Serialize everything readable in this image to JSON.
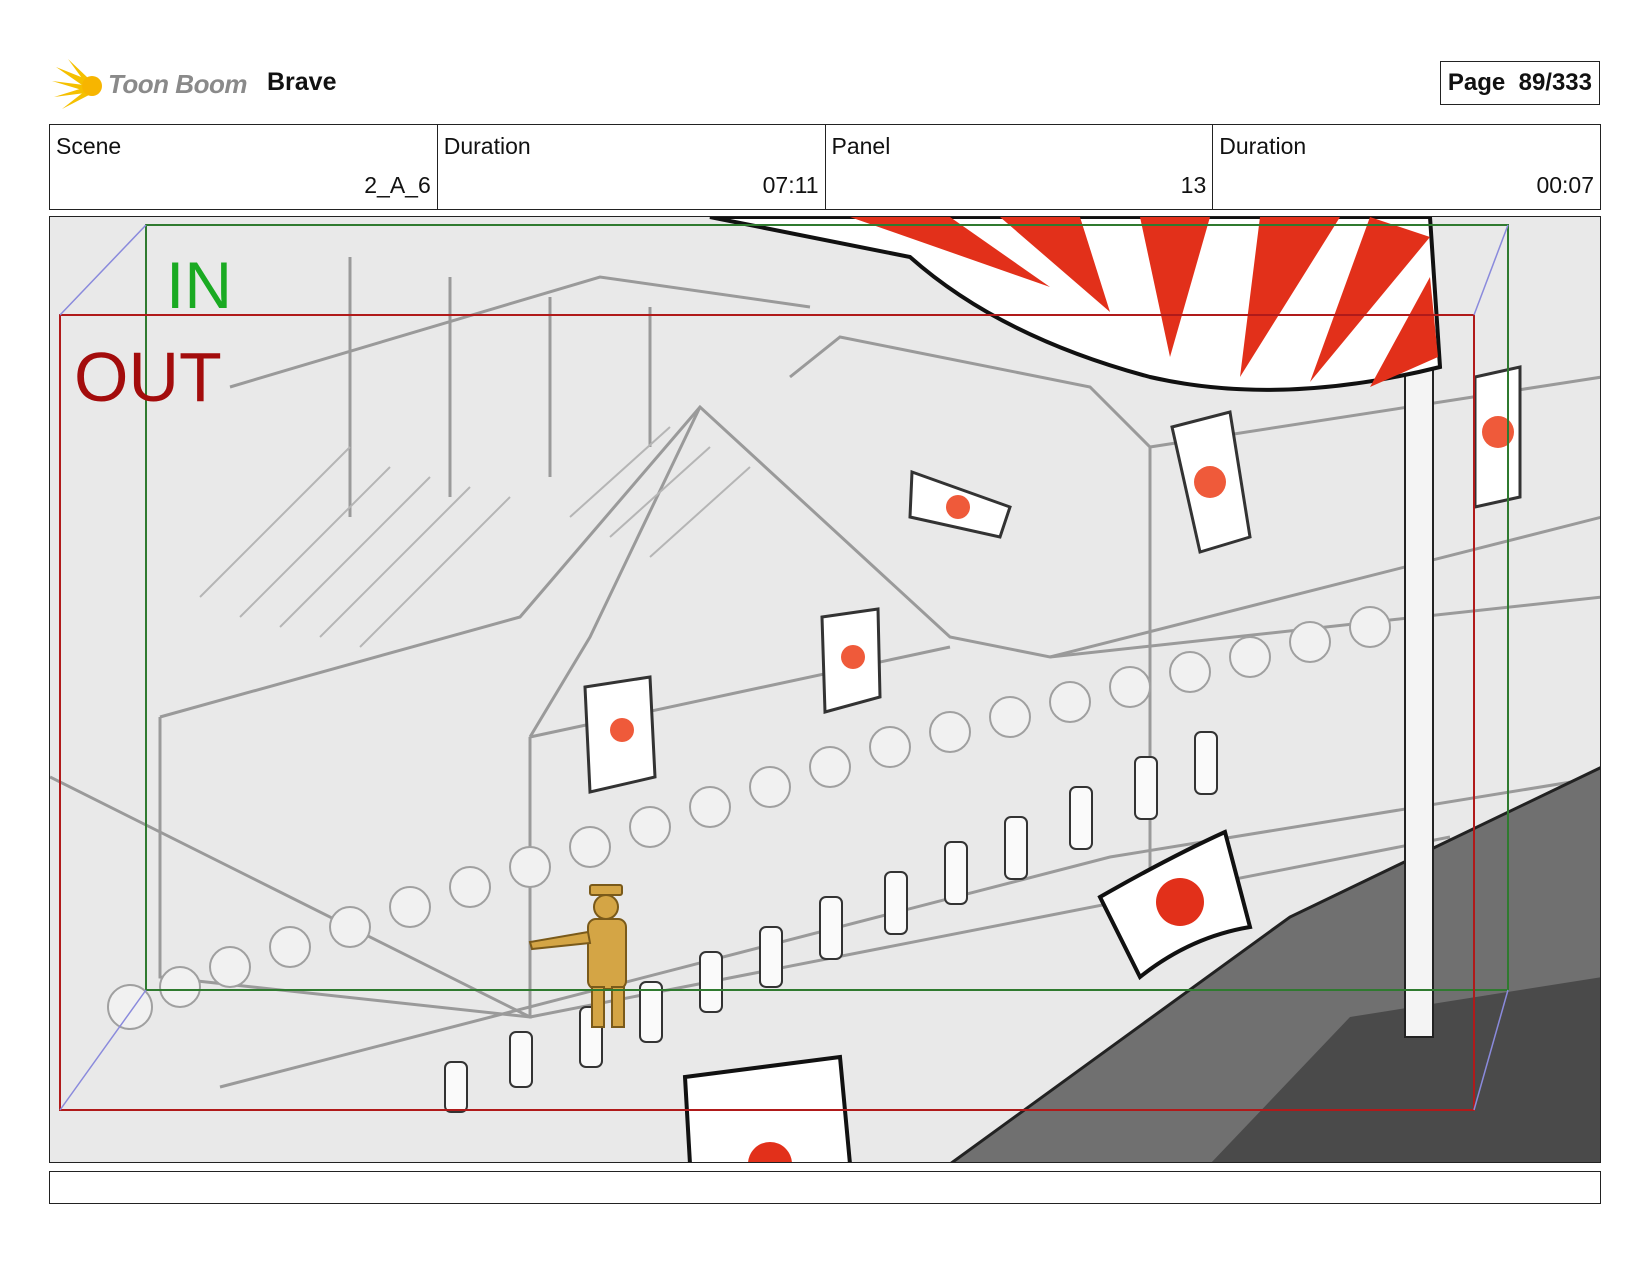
{
  "header": {
    "brand": "Toon Boom",
    "project": "Brave",
    "page_label": "Page",
    "page_number": "89/333",
    "brand_color": "#f5c000"
  },
  "info": {
    "scene_label": "Scene",
    "scene_value": "2_A_6",
    "duration_label": "Duration",
    "duration_value": "07:11",
    "panel_label": "Panel",
    "panel_value": "13",
    "panel_duration_label": "Duration",
    "panel_duration_value": "00:07"
  },
  "frame": {
    "in_label": "IN",
    "out_label": "OUT",
    "in_color": "#1aaa22",
    "out_color": "#a30c0c"
  },
  "caption": {
    "text": ""
  }
}
